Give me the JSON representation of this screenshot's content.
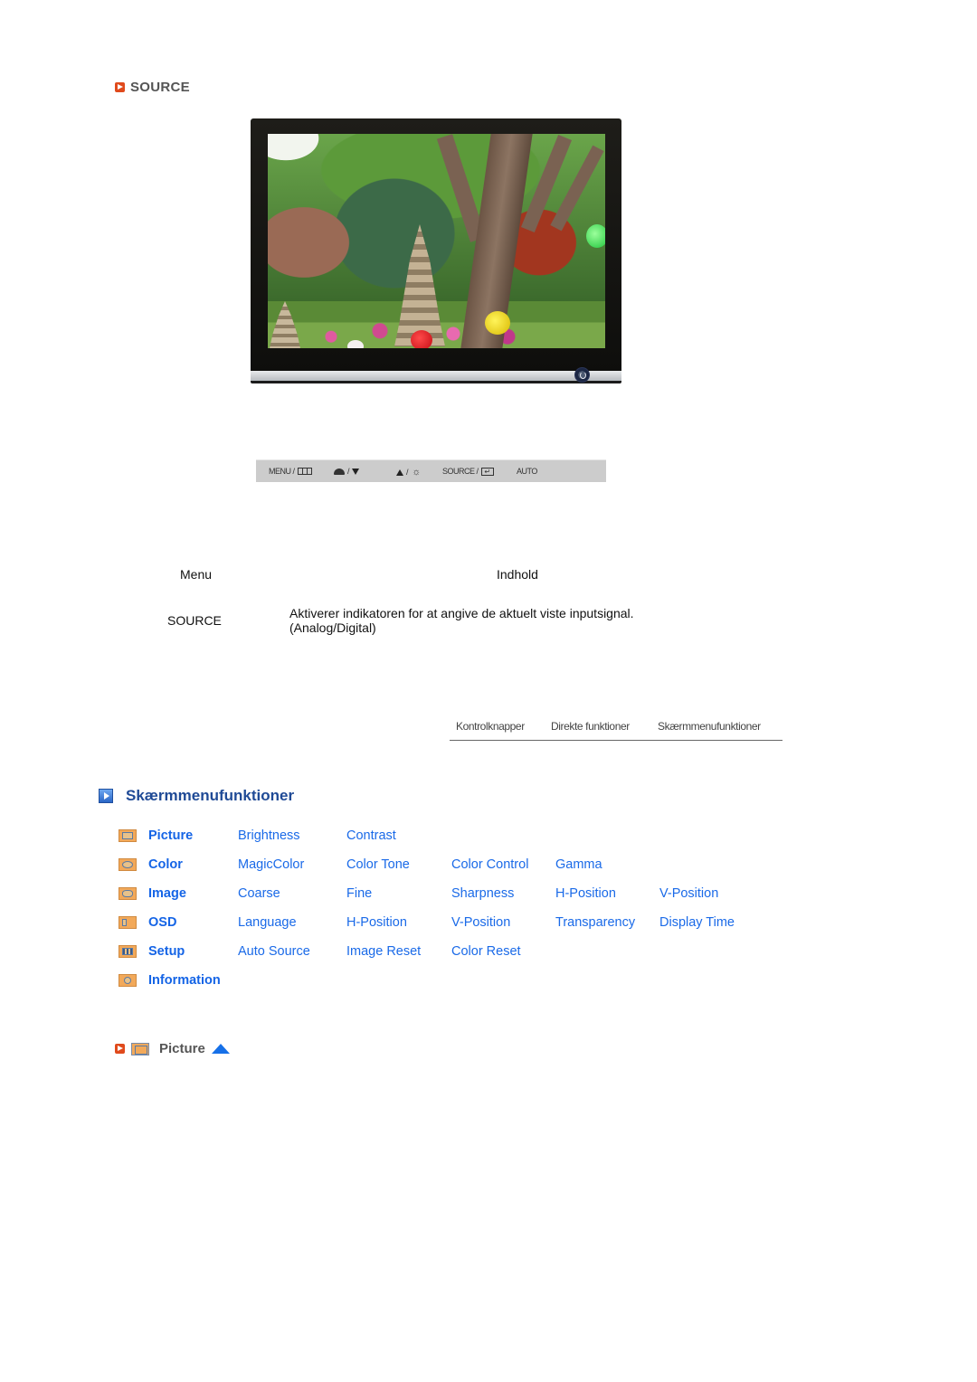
{
  "source_section": {
    "title": "SOURCE",
    "icon": "red-play-icon"
  },
  "monitor_image": {
    "description": "monitor-with-garden-photo",
    "power_button_icon": "power-icon"
  },
  "button_bar": {
    "items": [
      {
        "label": "MENU /",
        "icon": "menu-grid-icon"
      },
      {
        "label": "/",
        "icon": "magic-down-icon"
      },
      {
        "label": "/",
        "icon": "up-brightness-icon"
      },
      {
        "label": "SOURCE /",
        "icon": "enter-icon"
      },
      {
        "label": "AUTO",
        "icon": ""
      }
    ]
  },
  "table": {
    "headers": {
      "menu": "Menu",
      "content": "Indhold"
    },
    "rows": [
      {
        "menu": "SOURCE",
        "content": "Aktiverer indikatoren for at angive de aktuelt viste inputsignal.",
        "content_line2": "(Analog/Digital)"
      }
    ]
  },
  "tab_nav": {
    "tabs": [
      "Kontrolknapper",
      "Direkte funktioner",
      "Skærmmenufunktioner"
    ]
  },
  "osd_section": {
    "title": "Skærmmenufunktioner",
    "icon": "blue-play-icon",
    "categories": [
      {
        "name": "Picture",
        "icon": "picture-icon",
        "items": [
          "Brightness",
          "Contrast"
        ]
      },
      {
        "name": "Color",
        "icon": "color-icon",
        "items": [
          "MagicColor",
          "Color Tone",
          "Color Control",
          "Gamma"
        ]
      },
      {
        "name": "Image",
        "icon": "image-icon",
        "items": [
          "Coarse",
          "Fine",
          "Sharpness",
          "H-Position",
          "V-Position"
        ]
      },
      {
        "name": "OSD",
        "icon": "osd-icon",
        "items": [
          "Language",
          "H-Position",
          "V-Position",
          "Transparency",
          "Display Time"
        ]
      },
      {
        "name": "Setup",
        "icon": "setup-icon",
        "items": [
          "Auto Source",
          "Image Reset",
          "Color Reset"
        ]
      },
      {
        "name": "Information",
        "icon": "information-icon",
        "items": []
      }
    ]
  },
  "picture_heading": {
    "label": "Picture",
    "icon": "picture-icon",
    "up_icon": "up-arrow-icon"
  },
  "colors": {
    "link_blue": "#1a6ae8",
    "heading_blue": "#1f4a96",
    "accent_red": "#e04a1c",
    "icon_orange": "#f2a95a"
  }
}
